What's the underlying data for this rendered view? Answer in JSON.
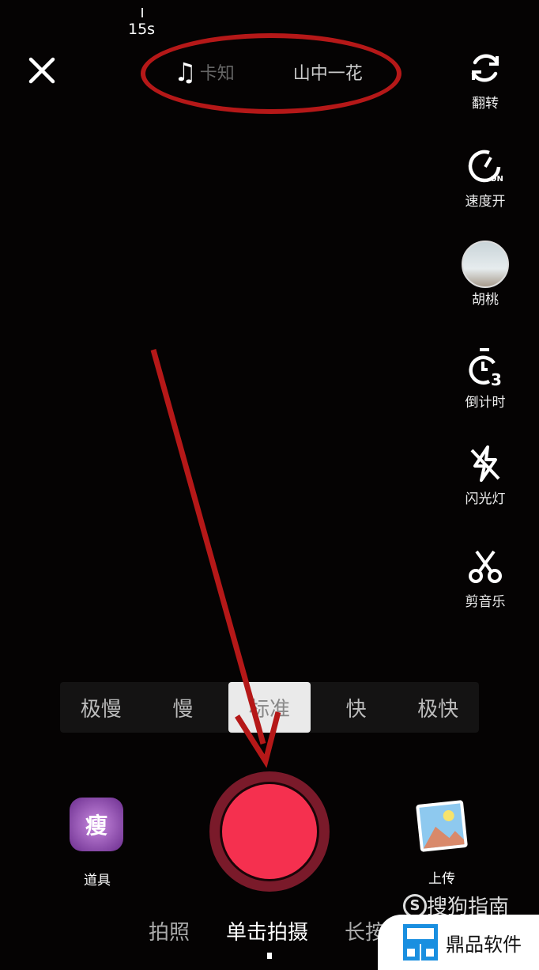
{
  "top": {
    "duration": "15s",
    "music_text_left": "卡知",
    "music_text_right": "山中一花"
  },
  "side_tools": [
    {
      "icon": "flip-camera-icon",
      "label": "翻转"
    },
    {
      "icon": "speed-on-icon",
      "label": "速度开"
    },
    {
      "icon": "filter-avatar-icon",
      "label": "胡桃"
    },
    {
      "icon": "countdown-timer-icon",
      "label": "倒计时"
    },
    {
      "icon": "flash-off-icon",
      "label": "闪光灯"
    },
    {
      "icon": "scissors-icon",
      "label": "剪音乐"
    }
  ],
  "speed_options": [
    "极慢",
    "慢",
    "标准",
    "快",
    "极快"
  ],
  "speed_selected": "标准",
  "bottom": {
    "props_label": "道具",
    "props_badge": "瘦",
    "upload_label": "上传"
  },
  "modes": [
    "拍照",
    "单击拍摄",
    "长按拍摄"
  ],
  "mode_selected": "单击拍摄",
  "watermarks": {
    "sogou": "搜狗指南",
    "dingpin": "鼎品软件"
  },
  "colors": {
    "record": "#f5304f",
    "annotation": "#b51818"
  }
}
